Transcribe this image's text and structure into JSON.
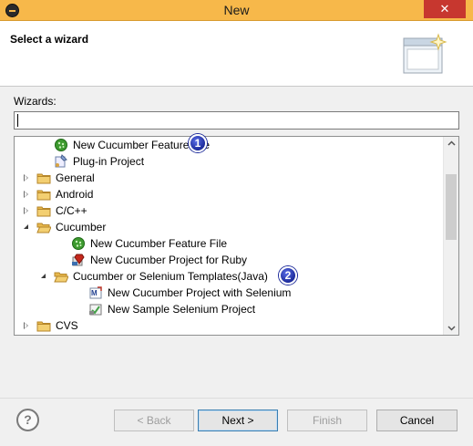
{
  "window": {
    "title": "New",
    "close_glyph": "✕"
  },
  "header": {
    "heading": "Select a wizard"
  },
  "wizards_label": "Wizards:",
  "filter": {
    "value": ""
  },
  "tree": {
    "items": [
      {
        "label": "New Cucumber Feature File",
        "icon": "cucumber-icon",
        "level": 1,
        "expander": "none"
      },
      {
        "label": "Plug-in Project",
        "icon": "plugin-project-icon",
        "level": 1,
        "expander": "none"
      },
      {
        "label": "General",
        "icon": "folder-icon",
        "level": 0,
        "expander": "collapsed"
      },
      {
        "label": "Android",
        "icon": "folder-icon",
        "level": 0,
        "expander": "collapsed"
      },
      {
        "label": "C/C++",
        "icon": "folder-icon",
        "level": 0,
        "expander": "collapsed"
      },
      {
        "label": "Cucumber",
        "icon": "folder-open-icon",
        "level": 0,
        "expander": "expanded"
      },
      {
        "label": "New Cucumber Feature File",
        "icon": "cucumber-icon",
        "level": 2,
        "expander": "none"
      },
      {
        "label": "New Cucumber Project for Ruby",
        "icon": "ruby-project-icon",
        "level": 2,
        "expander": "none"
      },
      {
        "label": "Cucumber or Selenium Templates(Java)",
        "icon": "folder-open-icon",
        "level": 1,
        "expander": "expanded"
      },
      {
        "label": "New Cucumber Project with Selenium",
        "icon": "maven-project-icon",
        "level": 3,
        "expander": "none"
      },
      {
        "label": "New Sample Selenium Project",
        "icon": "selenium-project-icon",
        "level": 3,
        "expander": "none"
      },
      {
        "label": "CVS",
        "icon": "folder-icon",
        "level": 0,
        "expander": "collapsed"
      }
    ],
    "scroll_fraction": 0.05
  },
  "annotations": {
    "badge1": "1",
    "badge2": "2"
  },
  "buttons": {
    "help": "?",
    "back": "< Back",
    "next": "Next >",
    "finish": "Finish",
    "cancel": "Cancel"
  },
  "colors": {
    "titlebar": "#f7b84a",
    "close_button": "#c7372f",
    "cucumber_green": "#3d9a2f",
    "folder_yellow": "#e7b84c",
    "badge_blue": "#1c2a9a"
  }
}
